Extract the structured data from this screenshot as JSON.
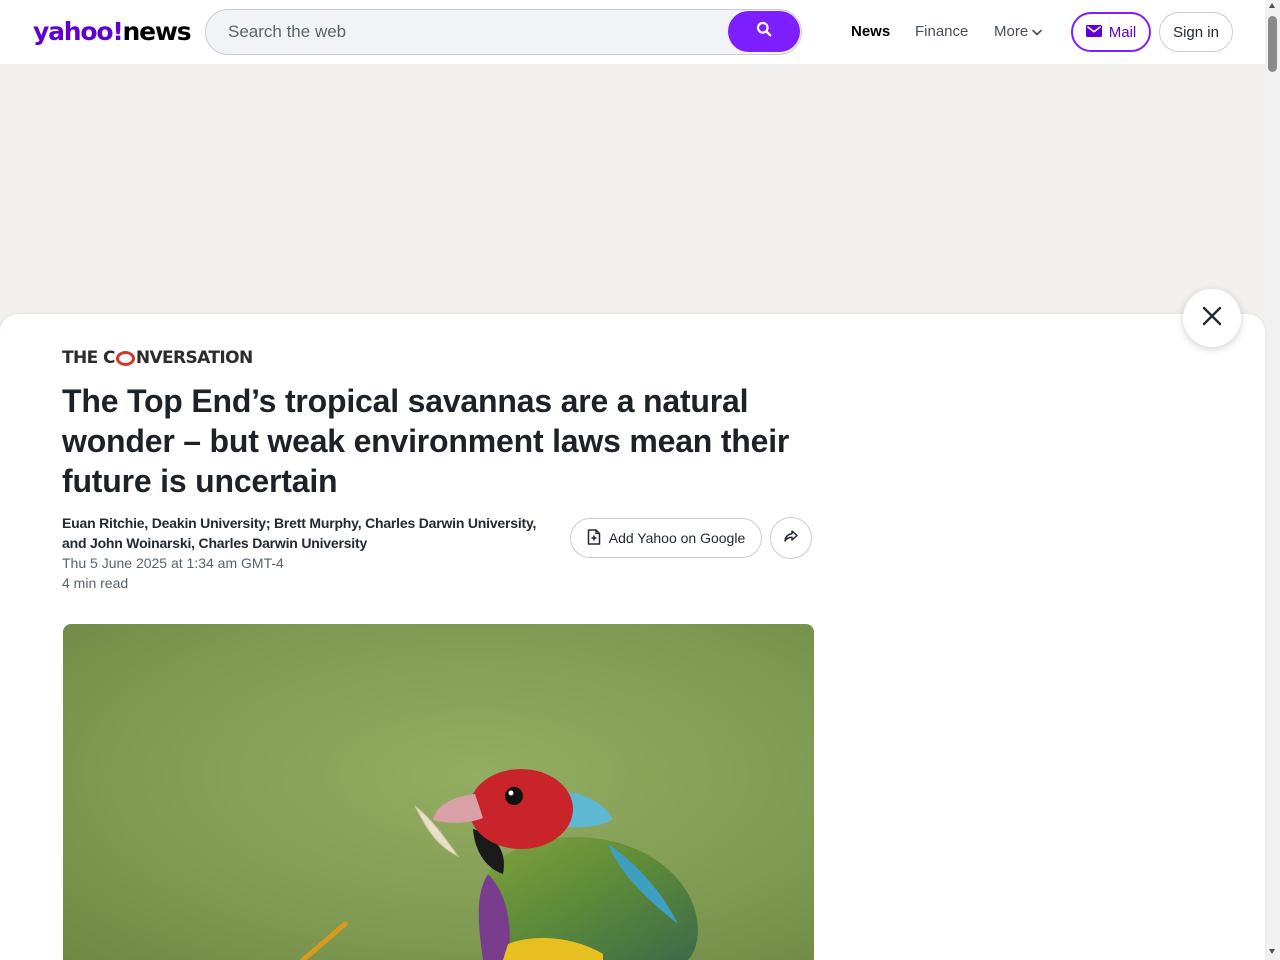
{
  "header": {
    "logo": {
      "part1": "yahoo!",
      "part2": "news"
    },
    "search": {
      "placeholder": "Search the web",
      "value": ""
    },
    "nav": [
      {
        "label": "News"
      },
      {
        "label": "Finance"
      },
      {
        "label": "More"
      }
    ],
    "mail_label": "Mail",
    "signin_label": "Sign in"
  },
  "article": {
    "publisher": {
      "part1": "THE C",
      "part2": "NVERSATION"
    },
    "title": "The Top End’s tropical savannas are a natural wonder – but weak environment laws mean their future is uncertain",
    "authors": "Euan Ritchie, Deakin University; Brett Murphy, Charles Darwin University, and John Woinarski, Charles Darwin University",
    "date": "Thu 5 June 2025 at 1:34 am GMT-4",
    "read_time": "4 min read",
    "add_google_label": "Add Yahoo on Google"
  },
  "icons": {
    "search": "search-icon",
    "chevron": "chevron-down-icon",
    "mail": "mail-icon",
    "close": "close-icon",
    "add_doc": "add-document-icon",
    "share": "share-icon"
  },
  "colors": {
    "brand_purple": "#7e1fff",
    "logo_purple": "#6001d2",
    "conversation_red": "#d8352a"
  }
}
